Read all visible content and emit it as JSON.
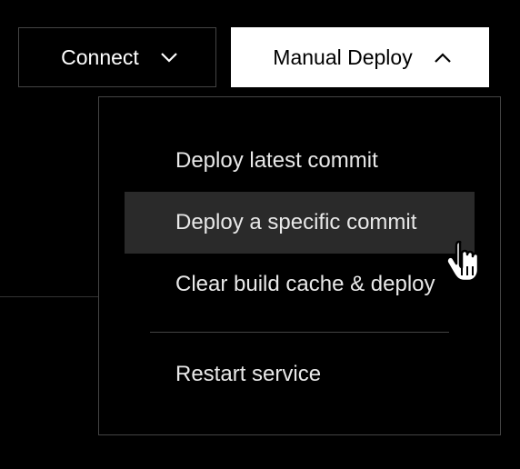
{
  "toolbar": {
    "connect_label": "Connect",
    "deploy_label": "Manual Deploy"
  },
  "menu": {
    "items": [
      {
        "label": "Deploy latest commit"
      },
      {
        "label": "Deploy a specific commit"
      },
      {
        "label": "Clear build cache & deploy"
      },
      {
        "label": "Restart service"
      }
    ]
  }
}
